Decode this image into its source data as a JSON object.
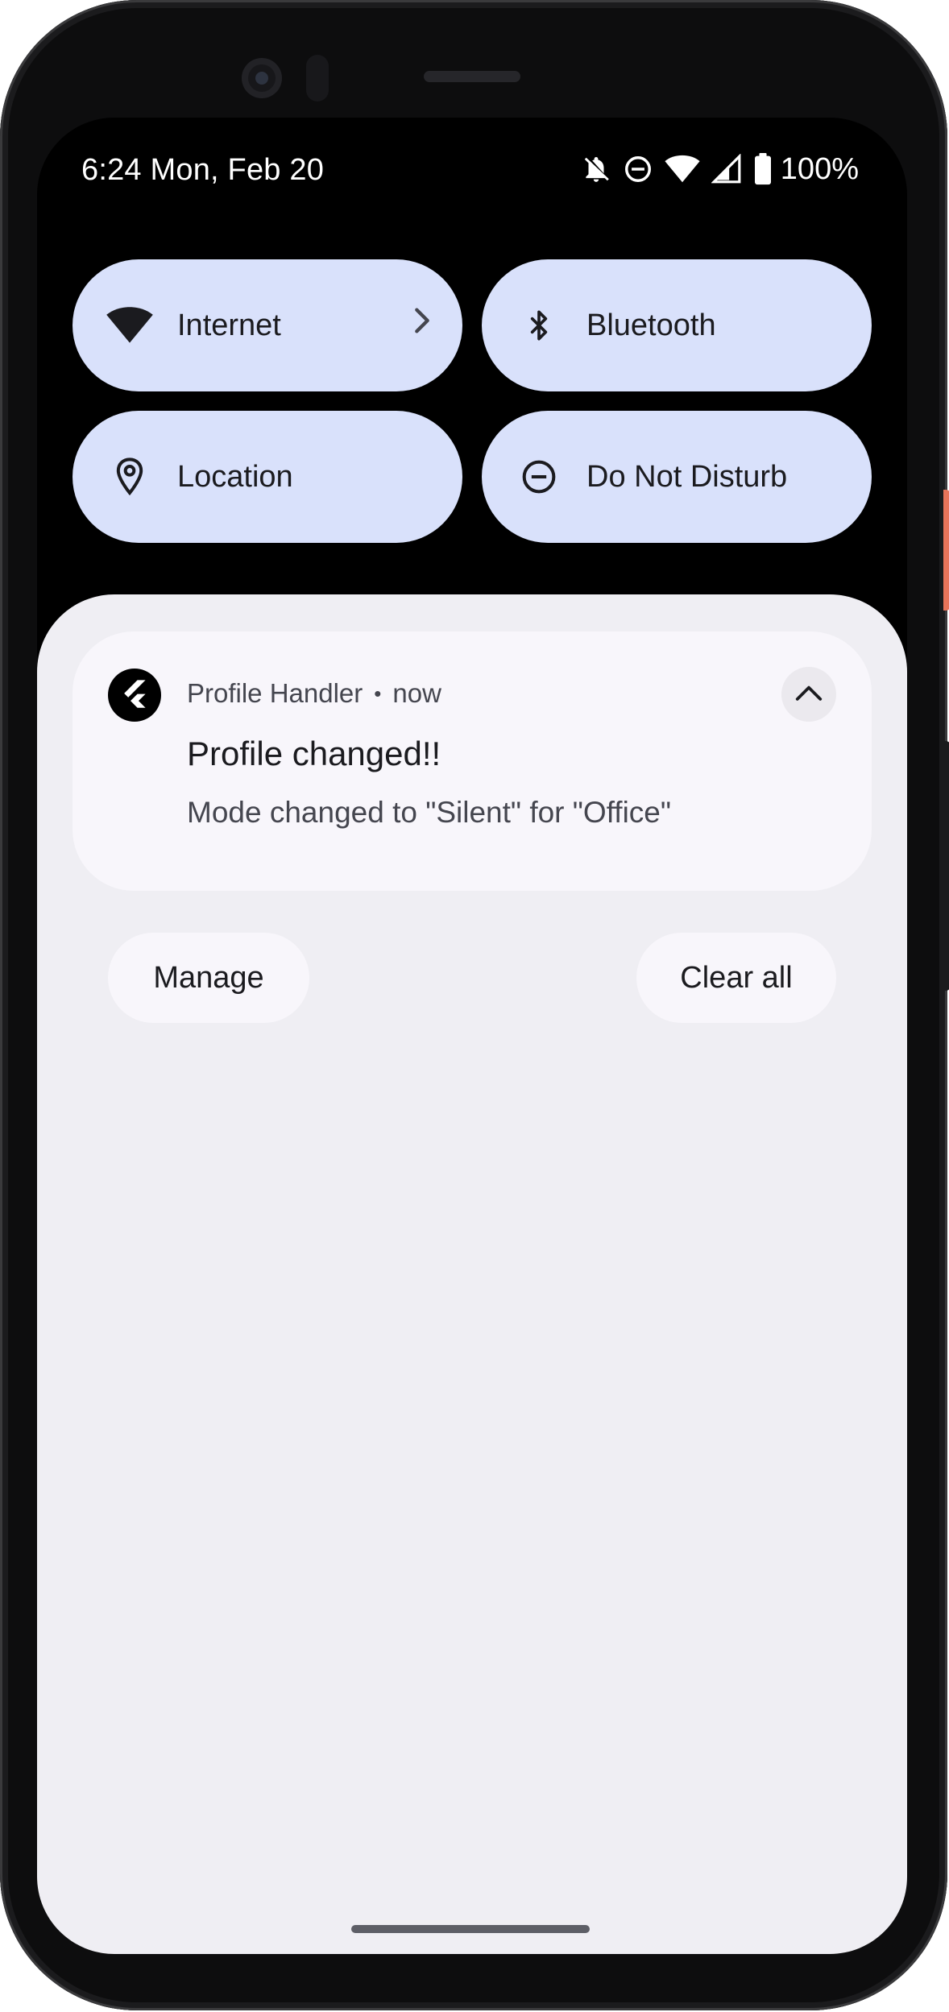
{
  "status_bar": {
    "time_date": "6:24 Mon, Feb 20",
    "battery_percent": "100%",
    "icons": [
      "notifications-off-icon",
      "do-not-disturb-icon",
      "wifi-icon",
      "cell-signal-icon",
      "battery-icon"
    ]
  },
  "quick_settings": {
    "tiles": [
      {
        "label": "Internet",
        "icon": "wifi-icon",
        "has_chevron": true
      },
      {
        "label": "Bluetooth",
        "icon": "bluetooth-icon"
      },
      {
        "label": "Location",
        "icon": "location-pin-icon"
      },
      {
        "label": "Do Not Disturb",
        "icon": "do-not-disturb-icon"
      }
    ]
  },
  "notification": {
    "app_name": "Profile Handler",
    "separator": "•",
    "time": "now",
    "title": "Profile changed!!",
    "body": "Mode changed to \"Silent\" for \"Office\"",
    "app_icon": "flutter-logo-icon",
    "expand_state": "expanded"
  },
  "actions": {
    "manage_label": "Manage",
    "clear_all_label": "Clear all"
  },
  "colors": {
    "tile_background": "#d9e1fb",
    "shade_background": "#efeef3",
    "card_background": "#f8f6fb",
    "text_primary": "#1b1b1f",
    "text_secondary": "#45464f"
  }
}
